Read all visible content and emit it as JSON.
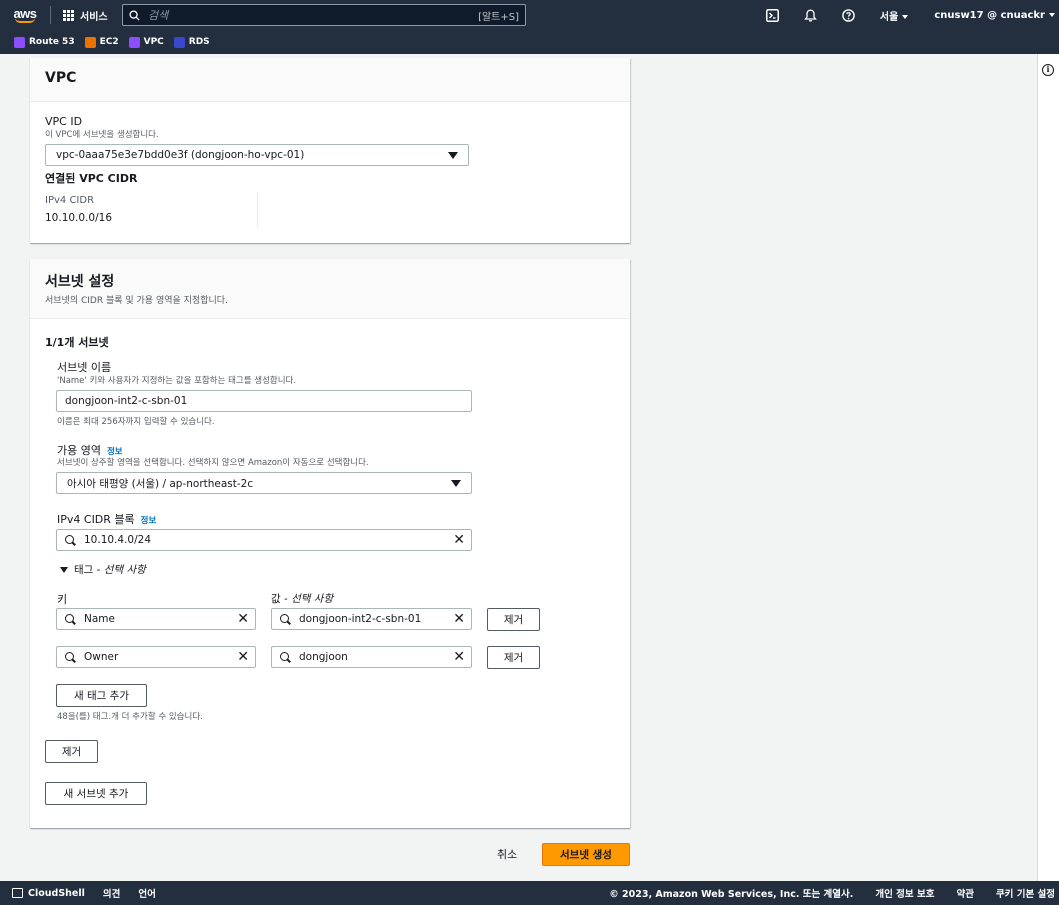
{
  "topnav": {
    "logo_text": "aws",
    "services_label": "서비스",
    "search_placeholder": "검색",
    "search_hint": "[알트+S]",
    "region": "서울",
    "account": "cnusw17 @ cnuackr"
  },
  "favorites": [
    {
      "label": "Route 53",
      "color": "#8c4fff"
    },
    {
      "label": "EC2",
      "color": "#ed7100"
    },
    {
      "label": "VPC",
      "color": "#8c4fff"
    },
    {
      "label": "RDS",
      "color": "#3b48cc"
    }
  ],
  "vpc_panel": {
    "title": "VPC",
    "vpc_id_label": "VPC ID",
    "vpc_id_desc": "이 VPC에 서브넷을 생성합니다.",
    "vpc_selected": "vpc-0aaa75e3e7bdd0e3f (dongjoon-ho-vpc-01)",
    "cidr_heading": "연결된 VPC CIDR",
    "ipv4_label": "IPv4 CIDR",
    "ipv4_value": "10.10.0.0/16"
  },
  "subnet_panel": {
    "title": "서브넷 설정",
    "desc": "서브넷의 CIDR 블록 및 가용 영역을 지정합니다.",
    "subnet_count": "1/1개 서브넷",
    "name_label": "서브넷 이름",
    "name_desc": "'Name' 키와 사용자가 지정하는 값을 포함하는 태그를 생성합니다.",
    "name_value": "dongjoon-int2-c-sbn-01",
    "name_hint": "이름은 최대 256자까지 입력할 수 있습니다.",
    "az_label": "가용 영역",
    "az_info": "정보",
    "az_desc": "서브넷이 상주할 영역을 선택합니다. 선택하지 않으면 Amazon이 자동으로 선택합니다.",
    "az_value": "아시아 태평양 (서울) / ap-northeast-2c",
    "cidr_label": "IPv4 CIDR 블록",
    "cidr_info": "정보",
    "cidr_value": "10.10.4.0/24",
    "tags_toggle": "태그 - ",
    "tags_toggle_optional": "선택 사항",
    "key_header": "키",
    "value_header": "값 - ",
    "value_header_optional": "선택 사항",
    "tags": [
      {
        "key": "Name",
        "value": "dongjoon-int2-c-sbn-01",
        "remove": "제거"
      },
      {
        "key": "Owner",
        "value": "dongjoon",
        "remove": "제거"
      }
    ],
    "add_tag": "새 태그 추가",
    "tag_limit": "48을(를) 태그.개 더 추가할 수 있습니다.",
    "remove_subnet": "제거",
    "add_subnet": "새 서브넷 추가"
  },
  "actions": {
    "cancel": "취소",
    "create": "서브넷 생성"
  },
  "footer": {
    "cloudshell": "CloudShell",
    "feedback": "의견",
    "language": "언어",
    "copyright": "© 2023, Amazon Web Services, Inc. 또는 계열사.",
    "privacy": "개인 정보 보호",
    "terms": "약관",
    "cookies": "쿠키 기본 설정"
  }
}
